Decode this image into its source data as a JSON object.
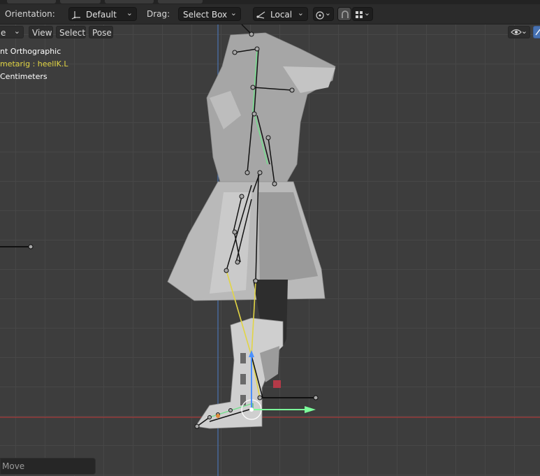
{
  "header": {
    "orientation_label": "Orientation:",
    "orientation_value": "Default",
    "drag_label": "Drag:",
    "drag_value": "Select Box",
    "pivot_value": "Local",
    "snap_icon": "snap-icon",
    "overlay_icon": "overlay-icon"
  },
  "viewport_header": {
    "mode_value": "e",
    "menu": [
      "View",
      "Select",
      "Pose"
    ],
    "visibility_icon": "eye-icon",
    "gizmo_icon": "gizmo-icon"
  },
  "viewport_info": {
    "view_name": "nt Orthographic",
    "active_object": "metarig : heelIK.L",
    "units": "Centimeters"
  },
  "last_operator": {
    "label": "Move"
  },
  "colors": {
    "header_bg": "#2b2b2b",
    "viewport_bg": "#3d3d3d",
    "grid_line": "#474747",
    "x_axis": "#a83a3a",
    "z_axis": "#4a73b0",
    "selected_bone_yellow": "#e2d544",
    "active_bone_green": "#6fe08a",
    "gizmo_y_green": "#7cff9b",
    "gizmo_z_blue": "#4a90ff"
  }
}
